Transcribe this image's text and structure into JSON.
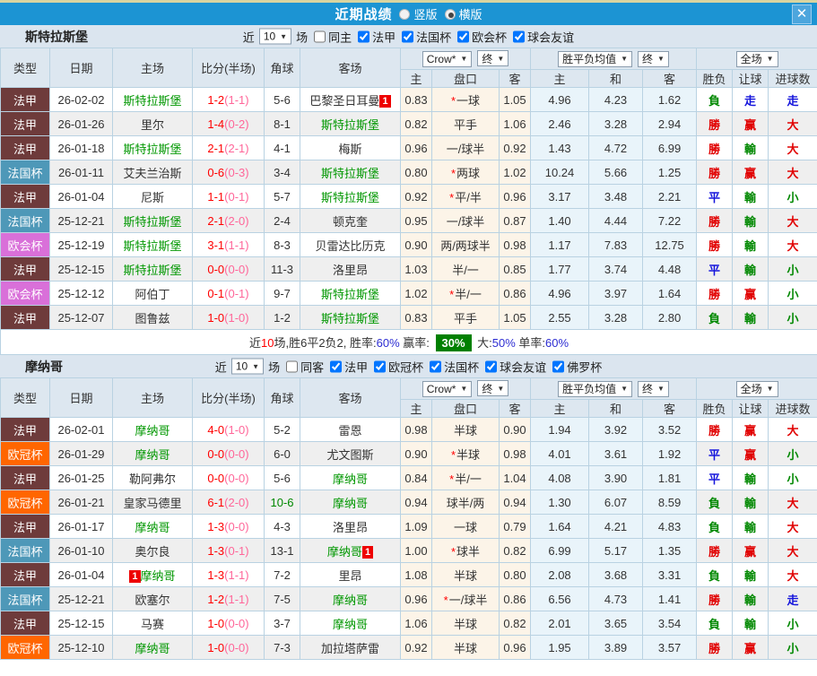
{
  "titlebar": {
    "title": "近期战绩",
    "radio_vertical": "竖版",
    "radio_horizontal": "横版",
    "close": "✕"
  },
  "colors": {
    "type": {
      "法甲": "#6e3b3b",
      "法国杯": "#4e98b8",
      "欧会杯": "#d970d9",
      "欧冠杯": "#ff6600"
    },
    "result": {
      "勝": "#e10000",
      "負": "#008800",
      "平": "#1414dc",
      "赢": "#e10000",
      "輸": "#008800",
      "走": "#1414dc",
      "大": "#e10000",
      "小": "#008800"
    }
  },
  "table_header": {
    "left": [
      "类型",
      "日期",
      "主场",
      "比分(半场)",
      "角球",
      "客场"
    ],
    "sub": [
      "主",
      "盘口",
      "客",
      "主",
      "和",
      "客",
      "胜负",
      "让球",
      "进球数"
    ],
    "controls": {
      "odds_company": "Crow*",
      "odds_final": "终",
      "avg": "胜平负均值",
      "avg_final": "终",
      "scope": "全场"
    }
  },
  "sections": [
    {
      "team": "斯特拉斯堡",
      "filter": {
        "near": "近",
        "count": "10",
        "unit": "场",
        "same": "同主",
        "same_checked": false,
        "leagues": [
          "法甲",
          "法国杯",
          "欧会杯",
          "球会友谊"
        ]
      },
      "rows": [
        {
          "type": "法甲",
          "date": "26-02-02",
          "home": "斯特拉斯堡",
          "home_green": true,
          "home_badge": "",
          "score": "1-2",
          "half": "(1-1)",
          "corner": "5-6",
          "corner_green": false,
          "away": "巴黎圣日耳曼",
          "away_green": false,
          "away_badge": "1",
          "odds_home": "0.83",
          "star": true,
          "handicap": "一球",
          "odds_away": "1.05",
          "avg_home": "4.96",
          "avg_draw": "4.23",
          "avg_away": "1.62",
          "result": "負",
          "handicap_result": "走",
          "goals_result": "走"
        },
        {
          "type": "法甲",
          "date": "26-01-26",
          "home": "里尔",
          "home_green": false,
          "home_badge": "",
          "score": "1-4",
          "half": "(0-2)",
          "corner": "8-1",
          "corner_green": false,
          "away": "斯特拉斯堡",
          "away_green": true,
          "away_badge": "",
          "odds_home": "0.82",
          "star": false,
          "handicap": "平手",
          "odds_away": "1.06",
          "avg_home": "2.46",
          "avg_draw": "3.28",
          "avg_away": "2.94",
          "result": "勝",
          "handicap_result": "赢",
          "goals_result": "大"
        },
        {
          "type": "法甲",
          "date": "26-01-18",
          "home": "斯特拉斯堡",
          "home_green": true,
          "home_badge": "",
          "score": "2-1",
          "half": "(2-1)",
          "corner": "4-1",
          "corner_green": false,
          "away": "梅斯",
          "away_green": false,
          "away_badge": "",
          "odds_home": "0.96",
          "star": false,
          "handicap": "一/球半",
          "odds_away": "0.92",
          "avg_home": "1.43",
          "avg_draw": "4.72",
          "avg_away": "6.99",
          "result": "勝",
          "handicap_result": "輸",
          "goals_result": "大"
        },
        {
          "type": "法国杯",
          "date": "26-01-11",
          "home": "艾夫兰治斯",
          "home_green": false,
          "home_badge": "",
          "score": "0-6",
          "half": "(0-3)",
          "corner": "3-4",
          "corner_green": false,
          "away": "斯特拉斯堡",
          "away_green": true,
          "away_badge": "",
          "odds_home": "0.80",
          "star": true,
          "handicap": "两球",
          "odds_away": "1.02",
          "avg_home": "10.24",
          "avg_draw": "5.66",
          "avg_away": "1.25",
          "result": "勝",
          "handicap_result": "赢",
          "goals_result": "大"
        },
        {
          "type": "法甲",
          "date": "26-01-04",
          "home": "尼斯",
          "home_green": false,
          "home_badge": "",
          "score": "1-1",
          "half": "(0-1)",
          "corner": "5-7",
          "corner_green": false,
          "away": "斯特拉斯堡",
          "away_green": true,
          "away_badge": "",
          "odds_home": "0.92",
          "star": true,
          "handicap": "平/半",
          "odds_away": "0.96",
          "avg_home": "3.17",
          "avg_draw": "3.48",
          "avg_away": "2.21",
          "result": "平",
          "handicap_result": "輸",
          "goals_result": "小"
        },
        {
          "type": "法国杯",
          "date": "25-12-21",
          "home": "斯特拉斯堡",
          "home_green": true,
          "home_badge": "",
          "score": "2-1",
          "half": "(2-0)",
          "corner": "2-4",
          "corner_green": false,
          "away": "顿克奎",
          "away_green": false,
          "away_badge": "",
          "odds_home": "0.95",
          "star": false,
          "handicap": "一/球半",
          "odds_away": "0.87",
          "avg_home": "1.40",
          "avg_draw": "4.44",
          "avg_away": "7.22",
          "result": "勝",
          "handicap_result": "輸",
          "goals_result": "大"
        },
        {
          "type": "欧会杯",
          "date": "25-12-19",
          "home": "斯特拉斯堡",
          "home_green": true,
          "home_badge": "",
          "score": "3-1",
          "half": "(1-1)",
          "corner": "8-3",
          "corner_green": false,
          "away": "贝雷达比历克",
          "away_green": false,
          "away_badge": "",
          "odds_home": "0.90",
          "star": false,
          "handicap": "两/两球半",
          "odds_away": "0.98",
          "avg_home": "1.17",
          "avg_draw": "7.83",
          "avg_away": "12.75",
          "result": "勝",
          "handicap_result": "輸",
          "goals_result": "大"
        },
        {
          "type": "法甲",
          "date": "25-12-15",
          "home": "斯特拉斯堡",
          "home_green": true,
          "home_badge": "",
          "score": "0-0",
          "half": "(0-0)",
          "corner": "11-3",
          "corner_green": false,
          "away": "洛里昂",
          "away_green": false,
          "away_badge": "",
          "odds_home": "1.03",
          "star": false,
          "handicap": "半/一",
          "odds_away": "0.85",
          "avg_home": "1.77",
          "avg_draw": "3.74",
          "avg_away": "4.48",
          "result": "平",
          "handicap_result": "輸",
          "goals_result": "小"
        },
        {
          "type": "欧会杯",
          "date": "25-12-12",
          "home": "阿伯丁",
          "home_green": false,
          "home_badge": "",
          "score": "0-1",
          "half": "(0-1)",
          "corner": "9-7",
          "corner_green": false,
          "away": "斯特拉斯堡",
          "away_green": true,
          "away_badge": "",
          "odds_home": "1.02",
          "star": true,
          "handicap": "半/一",
          "odds_away": "0.86",
          "avg_home": "4.96",
          "avg_draw": "3.97",
          "avg_away": "1.64",
          "result": "勝",
          "handicap_result": "赢",
          "goals_result": "小"
        },
        {
          "type": "法甲",
          "date": "25-12-07",
          "home": "图鲁兹",
          "home_green": false,
          "home_badge": "",
          "score": "1-0",
          "half": "(1-0)",
          "corner": "1-2",
          "corner_green": false,
          "away": "斯特拉斯堡",
          "away_green": true,
          "away_badge": "",
          "odds_home": "0.83",
          "star": false,
          "handicap": "平手",
          "odds_away": "1.05",
          "avg_home": "2.55",
          "avg_draw": "3.28",
          "avg_away": "2.80",
          "result": "負",
          "handicap_result": "輸",
          "goals_result": "小"
        }
      ],
      "summary": [
        {
          "t": "近",
          "s": "dark"
        },
        {
          "t": "10",
          "s": "red"
        },
        {
          "t": "场,胜6平2负2, 胜率:",
          "s": "dark"
        },
        {
          "t": "60%",
          "s": "blue"
        },
        {
          "t": " 赢率: ",
          "s": "dark"
        },
        {
          "t": "30%",
          "s": "badge"
        },
        {
          "t": " 大:",
          "s": "dark"
        },
        {
          "t": "50%",
          "s": "blue"
        },
        {
          "t": " 单率:",
          "s": "dark"
        },
        {
          "t": "60%",
          "s": "blue"
        }
      ]
    },
    {
      "team": "摩纳哥",
      "filter": {
        "near": "近",
        "count": "10",
        "unit": "场",
        "same": "同客",
        "same_checked": false,
        "leagues": [
          "法甲",
          "欧冠杯",
          "法国杯",
          "球会友谊",
          "佛罗杯"
        ]
      },
      "rows": [
        {
          "type": "法甲",
          "date": "26-02-01",
          "home": "摩纳哥",
          "home_green": true,
          "home_badge": "",
          "score": "4-0",
          "half": "(1-0)",
          "corner": "5-2",
          "corner_green": false,
          "away": "雷恩",
          "away_green": false,
          "away_badge": "",
          "odds_home": "0.98",
          "star": false,
          "handicap": "半球",
          "odds_away": "0.90",
          "avg_home": "1.94",
          "avg_draw": "3.92",
          "avg_away": "3.52",
          "result": "勝",
          "handicap_result": "赢",
          "goals_result": "大"
        },
        {
          "type": "欧冠杯",
          "date": "26-01-29",
          "home": "摩纳哥",
          "home_green": true,
          "home_badge": "",
          "score": "0-0",
          "half": "(0-0)",
          "corner": "6-0",
          "corner_green": false,
          "away": "尤文图斯",
          "away_green": false,
          "away_badge": "",
          "odds_home": "0.90",
          "star": true,
          "handicap": "半球",
          "odds_away": "0.98",
          "avg_home": "4.01",
          "avg_draw": "3.61",
          "avg_away": "1.92",
          "result": "平",
          "handicap_result": "赢",
          "goals_result": "小"
        },
        {
          "type": "法甲",
          "date": "26-01-25",
          "home": "勒阿弗尔",
          "home_green": false,
          "home_badge": "",
          "score": "0-0",
          "half": "(0-0)",
          "corner": "5-6",
          "corner_green": false,
          "away": "摩纳哥",
          "away_green": true,
          "away_badge": "",
          "odds_home": "0.84",
          "star": true,
          "handicap": "半/一",
          "odds_away": "1.04",
          "avg_home": "4.08",
          "avg_draw": "3.90",
          "avg_away": "1.81",
          "result": "平",
          "handicap_result": "輸",
          "goals_result": "小"
        },
        {
          "type": "欧冠杯",
          "date": "26-01-21",
          "home": "皇家马德里",
          "home_green": false,
          "home_badge": "",
          "score": "6-1",
          "half": "(2-0)",
          "corner": "10-6",
          "corner_green": true,
          "away": "摩纳哥",
          "away_green": true,
          "away_badge": "",
          "odds_home": "0.94",
          "star": false,
          "handicap": "球半/两",
          "odds_away": "0.94",
          "avg_home": "1.30",
          "avg_draw": "6.07",
          "avg_away": "8.59",
          "result": "負",
          "handicap_result": "輸",
          "goals_result": "大"
        },
        {
          "type": "法甲",
          "date": "26-01-17",
          "home": "摩纳哥",
          "home_green": true,
          "home_badge": "",
          "score": "1-3",
          "half": "(0-0)",
          "corner": "4-3",
          "corner_green": false,
          "away": "洛里昂",
          "away_green": false,
          "away_badge": "",
          "odds_home": "1.09",
          "star": false,
          "handicap": "一球",
          "odds_away": "0.79",
          "avg_home": "1.64",
          "avg_draw": "4.21",
          "avg_away": "4.83",
          "result": "負",
          "handicap_result": "輸",
          "goals_result": "大"
        },
        {
          "type": "法国杯",
          "date": "26-01-10",
          "home": "奥尔良",
          "home_green": false,
          "home_badge": "",
          "score": "1-3",
          "half": "(0-1)",
          "corner": "13-1",
          "corner_green": false,
          "away": "摩纳哥",
          "away_green": true,
          "away_badge": "1",
          "odds_home": "1.00",
          "star": true,
          "handicap": "球半",
          "odds_away": "0.82",
          "avg_home": "6.99",
          "avg_draw": "5.17",
          "avg_away": "1.35",
          "result": "勝",
          "handicap_result": "赢",
          "goals_result": "大"
        },
        {
          "type": "法甲",
          "date": "26-01-04",
          "home": "摩纳哥",
          "home_green": true,
          "home_badge": "1",
          "score": "1-3",
          "half": "(1-1)",
          "corner": "7-2",
          "corner_green": false,
          "away": "里昂",
          "away_green": false,
          "away_badge": "",
          "odds_home": "1.08",
          "star": false,
          "handicap": "半球",
          "odds_away": "0.80",
          "avg_home": "2.08",
          "avg_draw": "3.68",
          "avg_away": "3.31",
          "result": "負",
          "handicap_result": "輸",
          "goals_result": "大"
        },
        {
          "type": "法国杯",
          "date": "25-12-21",
          "home": "欧塞尔",
          "home_green": false,
          "home_badge": "",
          "score": "1-2",
          "half": "(1-1)",
          "corner": "7-5",
          "corner_green": false,
          "away": "摩纳哥",
          "away_green": true,
          "away_badge": "",
          "odds_home": "0.96",
          "star": true,
          "handicap": "一/球半",
          "odds_away": "0.86",
          "avg_home": "6.56",
          "avg_draw": "4.73",
          "avg_away": "1.41",
          "result": "勝",
          "handicap_result": "輸",
          "goals_result": "走"
        },
        {
          "type": "法甲",
          "date": "25-12-15",
          "home": "马赛",
          "home_green": false,
          "home_badge": "",
          "score": "1-0",
          "half": "(0-0)",
          "corner": "3-7",
          "corner_green": false,
          "away": "摩纳哥",
          "away_green": true,
          "away_badge": "",
          "odds_home": "1.06",
          "star": false,
          "handicap": "半球",
          "odds_away": "0.82",
          "avg_home": "2.01",
          "avg_draw": "3.65",
          "avg_away": "3.54",
          "result": "負",
          "handicap_result": "輸",
          "goals_result": "小"
        },
        {
          "type": "欧冠杯",
          "date": "25-12-10",
          "home": "摩纳哥",
          "home_green": true,
          "home_badge": "",
          "score": "1-0",
          "half": "(0-0)",
          "corner": "7-3",
          "corner_green": false,
          "away": "加拉塔萨雷",
          "away_green": false,
          "away_badge": "",
          "odds_home": "0.92",
          "star": false,
          "handicap": "半球",
          "odds_away": "0.96",
          "avg_home": "1.95",
          "avg_draw": "3.89",
          "avg_away": "3.57",
          "result": "勝",
          "handicap_result": "赢",
          "goals_result": "小"
        }
      ],
      "summary": null
    }
  ]
}
